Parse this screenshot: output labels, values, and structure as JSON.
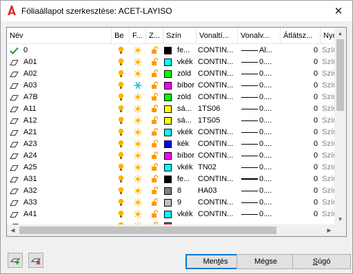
{
  "window": {
    "title": "Fóliaállapot szerkesztése: ACET-LAYISO",
    "close_glyph": "✕"
  },
  "columns": [
    {
      "key": "name",
      "label": "Név"
    },
    {
      "key": "on",
      "label": "Be"
    },
    {
      "key": "freeze",
      "label": "F..."
    },
    {
      "key": "lock",
      "label": "Z..."
    },
    {
      "key": "color",
      "label": "Szín"
    },
    {
      "key": "linetype",
      "label": "Vonaltí..."
    },
    {
      "key": "lineweight",
      "label": "Vonalv..."
    },
    {
      "key": "transparency",
      "label": "Átlátsz..."
    },
    {
      "key": "plotstyle",
      "label": "Nyo"
    }
  ],
  "rows": [
    {
      "name": "0",
      "current": true,
      "frozen": false,
      "color_name": "fe...",
      "color_hex": "#000000",
      "linetype": "CONTIN...",
      "lineweight": "Al...",
      "lw_thick": false,
      "transparency": "0",
      "plotstyle": "Szín_"
    },
    {
      "name": "A01",
      "current": false,
      "frozen": false,
      "color_name": "vkék",
      "color_hex": "#00ffff",
      "linetype": "CONTIN...",
      "lineweight": "0....",
      "lw_thick": false,
      "transparency": "0",
      "plotstyle": "Szín_"
    },
    {
      "name": "A02",
      "current": false,
      "frozen": false,
      "color_name": "zöld",
      "color_hex": "#00ff00",
      "linetype": "CONTIN...",
      "lineweight": "0....",
      "lw_thick": false,
      "transparency": "0",
      "plotstyle": "Szín_"
    },
    {
      "name": "A03",
      "current": false,
      "frozen": true,
      "color_name": "bíbor",
      "color_hex": "#ff00ff",
      "linetype": "CONTIN...",
      "lineweight": "0....",
      "lw_thick": false,
      "transparency": "0",
      "plotstyle": "Szín_"
    },
    {
      "name": "A7B",
      "current": false,
      "frozen": false,
      "color_name": "zöld",
      "color_hex": "#00ff00",
      "linetype": "CONTIN...",
      "lineweight": "0....",
      "lw_thick": false,
      "transparency": "0",
      "plotstyle": "Szín_"
    },
    {
      "name": "A11",
      "current": false,
      "frozen": false,
      "color_name": "sá...",
      "color_hex": "#ffff00",
      "linetype": "1TS06",
      "lineweight": "0....",
      "lw_thick": false,
      "transparency": "0",
      "plotstyle": "Szín_"
    },
    {
      "name": "A12",
      "current": false,
      "frozen": false,
      "color_name": "sá...",
      "color_hex": "#ffff00",
      "linetype": "1TS05",
      "lineweight": "0....",
      "lw_thick": false,
      "transparency": "0",
      "plotstyle": "Szín_"
    },
    {
      "name": "A21",
      "current": false,
      "frozen": false,
      "color_name": "vkék",
      "color_hex": "#00ffff",
      "linetype": "CONTIN...",
      "lineweight": "0....",
      "lw_thick": false,
      "transparency": "0",
      "plotstyle": "Szín_"
    },
    {
      "name": "A23",
      "current": false,
      "frozen": false,
      "color_name": "kék",
      "color_hex": "#0000ff",
      "linetype": "CONTIN...",
      "lineweight": "0....",
      "lw_thick": false,
      "transparency": "0",
      "plotstyle": "Szín_"
    },
    {
      "name": "A24",
      "current": false,
      "frozen": false,
      "color_name": "bíbor",
      "color_hex": "#ff00ff",
      "linetype": "CONTIN...",
      "lineweight": "0....",
      "lw_thick": false,
      "transparency": "0",
      "plotstyle": "Szín_"
    },
    {
      "name": "A25",
      "current": false,
      "frozen": false,
      "color_name": "vkék",
      "color_hex": "#00ffff",
      "linetype": "TN02",
      "lineweight": "0....",
      "lw_thick": false,
      "transparency": "0",
      "plotstyle": "Szín_"
    },
    {
      "name": "A31",
      "current": false,
      "frozen": false,
      "color_name": "fe...",
      "color_hex": "#000000",
      "linetype": "CONTIN...",
      "lineweight": "0....",
      "lw_thick": true,
      "transparency": "0",
      "plotstyle": "Szín_"
    },
    {
      "name": "A32",
      "current": false,
      "frozen": false,
      "color_name": "8",
      "color_hex": "#808080",
      "linetype": "HA03",
      "lineweight": "0....",
      "lw_thick": false,
      "transparency": "0",
      "plotstyle": "Szín_"
    },
    {
      "name": "A33",
      "current": false,
      "frozen": false,
      "color_name": "9",
      "color_hex": "#c0c0c0",
      "linetype": "CONTIN...",
      "lineweight": "0....",
      "lw_thick": false,
      "transparency": "0",
      "plotstyle": "Szín_"
    },
    {
      "name": "A41",
      "current": false,
      "frozen": false,
      "color_name": "vkék",
      "color_hex": "#00ffff",
      "linetype": "CONTIN...",
      "lineweight": "0....",
      "lw_thick": false,
      "transparency": "0",
      "plotstyle": "Szín_"
    },
    {
      "name": "",
      "current": false,
      "frozen": false,
      "color_name": "",
      "color_hex": "#ff0000",
      "linetype": "",
      "lineweight": "",
      "lw_thick": false,
      "transparency": "",
      "plotstyle": ""
    }
  ],
  "buttons": {
    "save": "Mentés",
    "cancel": "Mégse",
    "help": "Súgó"
  },
  "colors": {
    "bulb": "#ffb300",
    "sun": "#ffb300",
    "snowflake": "#20b8e0",
    "lock": "#ff9800",
    "check": "#2e9e3a",
    "accent": "#0078d7"
  }
}
